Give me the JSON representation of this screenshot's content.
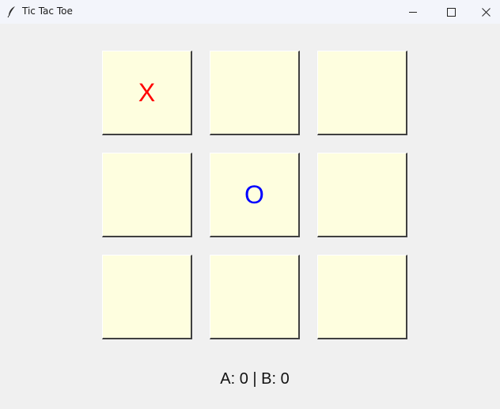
{
  "window": {
    "title": "Tic Tac Toe"
  },
  "board": {
    "cells": [
      {
        "mark": "X",
        "color": "#ff0000"
      },
      {
        "mark": "",
        "color": ""
      },
      {
        "mark": "",
        "color": ""
      },
      {
        "mark": "",
        "color": ""
      },
      {
        "mark": "O",
        "color": "#0000ff"
      },
      {
        "mark": "",
        "color": ""
      },
      {
        "mark": "",
        "color": ""
      },
      {
        "mark": "",
        "color": ""
      },
      {
        "mark": "",
        "color": ""
      }
    ],
    "cell_background": "#fefedf"
  },
  "score": {
    "text": "A: 0 | B: 0"
  },
  "icons": {
    "app": "feather-icon",
    "minimize": "minimize-icon",
    "maximize": "maximize-icon",
    "close": "close-icon"
  }
}
